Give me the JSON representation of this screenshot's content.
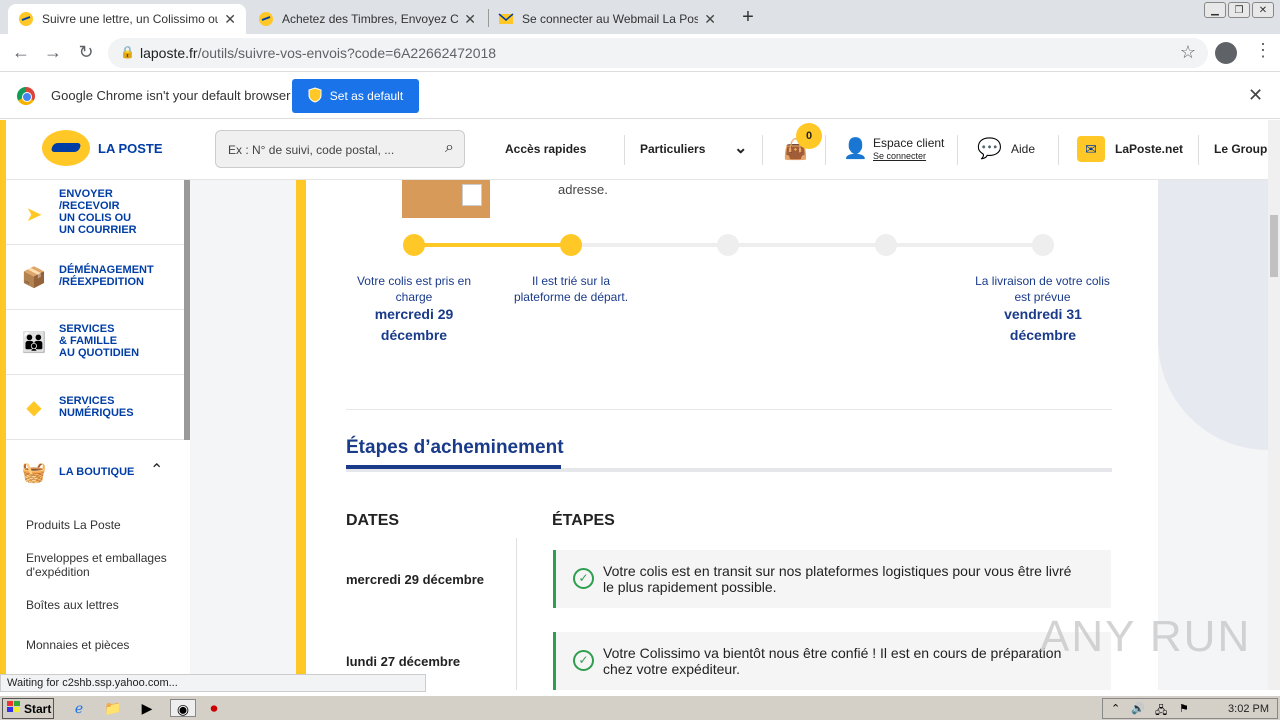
{
  "browser": {
    "tabs": [
      {
        "title": "Suivre une lettre, un Colissimo ou un",
        "icon": "laposte-favicon",
        "active": true
      },
      {
        "title": "Achetez des Timbres, Envoyez Cour",
        "icon": "laposte-favicon",
        "active": false
      },
      {
        "title": "Se connecter au Webmail La Poste -",
        "icon": "mail-favicon",
        "active": false
      }
    ],
    "url_host": "laposte.fr",
    "url_path": "/outils/suivre-vos-envois?code=6A22662472018"
  },
  "infobar": {
    "message": "Google Chrome isn't your default browser",
    "button": "Set as default"
  },
  "header": {
    "logo_text": "LA POSTE",
    "search_placeholder": "Ex : N° de suivi, code postal, ...",
    "nav": {
      "acces": "Accès rapides",
      "particuliers": "Particuliers",
      "cart_count": "0",
      "espace_client": "Espace client",
      "se_connecter": "Se connecter",
      "aide": "Aide",
      "laposte_net": "LaPoste.net",
      "groupe": "Le Group"
    }
  },
  "sidebar": {
    "items": [
      {
        "label": "ENVOYER\n/RECEVOIR\nUN COLIS OU\nUN COURRIER",
        "icon": "paper-plane-icon"
      },
      {
        "label": "DÉMÉNAGEMENT\n/RÉEXPEDITION",
        "icon": "moving-box-icon"
      },
      {
        "label": "SERVICES\n& FAMILLE\nAU QUOTIDIEN",
        "icon": "family-icon"
      },
      {
        "label": "SERVICES\nNUMÉRIQUES",
        "icon": "digital-icon"
      },
      {
        "label": "LA BOUTIQUE",
        "icon": "basket-icon"
      }
    ],
    "sub_items": [
      "Produits La Poste",
      "Enveloppes et emballages d'expédition",
      "Boîtes aux lettres",
      "Monnaies et pièces"
    ]
  },
  "tracking": {
    "adresse": "adresse.",
    "steps": [
      {
        "text": "Votre colis est pris en charge",
        "date": "mercredi 29 décembre",
        "done": true
      },
      {
        "text": "Il est trié sur la plateforme de départ.",
        "date": "",
        "done": true
      },
      {
        "text": "",
        "date": "",
        "done": false
      },
      {
        "text": "",
        "date": "",
        "done": false
      },
      {
        "text": "La livraison de votre colis est prévue",
        "date": "vendredi 31 décembre",
        "done": false
      }
    ]
  },
  "etapes": {
    "title": "Étapes d’acheminement",
    "col_dates": "DATES",
    "col_etapes": "ÉTAPES",
    "rows": [
      {
        "date": "mercredi 29 décembre",
        "text": "Votre colis est en transit sur nos plateformes logistiques pour vous être livré le plus rapidement possible."
      },
      {
        "date": "lundi 27 décembre",
        "text": "Votre Colissimo va bientôt nous être confié ! Il est en cours de préparation chez votre expéditeur."
      }
    ]
  },
  "status_text": "Waiting for c2shb.ssp.yahoo.com...",
  "watermark": "ANY RUN",
  "taskbar": {
    "start": "Start",
    "clock": "3:02 PM"
  },
  "colors": {
    "brand_yellow": "#ffc827",
    "brand_blue": "#003da5",
    "done_green": "#2e9e4f"
  }
}
